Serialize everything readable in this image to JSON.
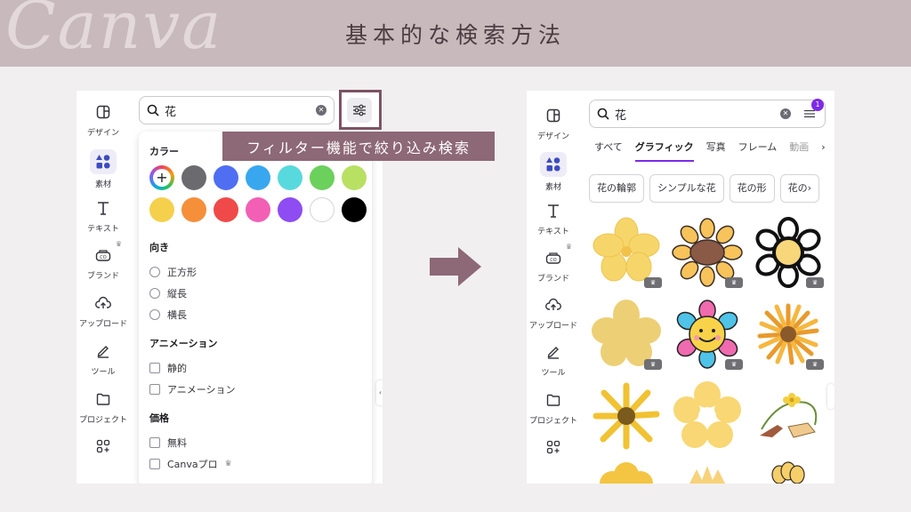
{
  "header": {
    "watermark": "Canva",
    "title": "基本的な検索方法"
  },
  "rail": {
    "items": [
      {
        "label": "デザイン",
        "icon": "layout-icon"
      },
      {
        "label": "素材",
        "icon": "elements-icon"
      },
      {
        "label": "テキスト",
        "icon": "text-icon"
      },
      {
        "label": "ブランド",
        "icon": "brand-icon"
      },
      {
        "label": "アップロード",
        "icon": "upload-cloud-icon"
      },
      {
        "label": "ツール",
        "icon": "pen-tool-icon"
      },
      {
        "label": "プロジェクト",
        "icon": "folder-icon"
      }
    ]
  },
  "left_panel": {
    "search_value": "花",
    "callout": "フィルター機能で絞り込み検索",
    "filters": {
      "color_title": "カラー",
      "colors": [
        "#6b6b6f",
        "#4f6ef2",
        "#38a7ef",
        "#58d9de",
        "#6bd05c",
        "#b8e063",
        "#f5d04c",
        "#f58f3a",
        "#ef4a49",
        "#f25fb5",
        "#8e4cf2",
        "#ffffff",
        "#000000"
      ],
      "orientation_title": "向き",
      "orientation_options": [
        "正方形",
        "縦長",
        "横長"
      ],
      "animation_title": "アニメーション",
      "animation_options": [
        "静的",
        "アニメーション"
      ],
      "price_title": "価格",
      "price_options": [
        "無料",
        "Canvaプロ"
      ],
      "price_crown": "♛"
    }
  },
  "right_panel": {
    "search_value": "花",
    "filter_badge": "1",
    "tabs": [
      "すべて",
      "グラフィック",
      "写真",
      "フレーム",
      "動画"
    ],
    "active_tab": "グラフィック",
    "tabs_more": "›",
    "chips": [
      "花の輪郭",
      "シンプルな花",
      "花の形",
      "花の"
    ],
    "chips_more": "›",
    "results_crown": "♛"
  },
  "colors": {
    "header_band": "#c8b9bd",
    "accent": "#8d6876",
    "canva_purple": "#7d2ae8"
  }
}
